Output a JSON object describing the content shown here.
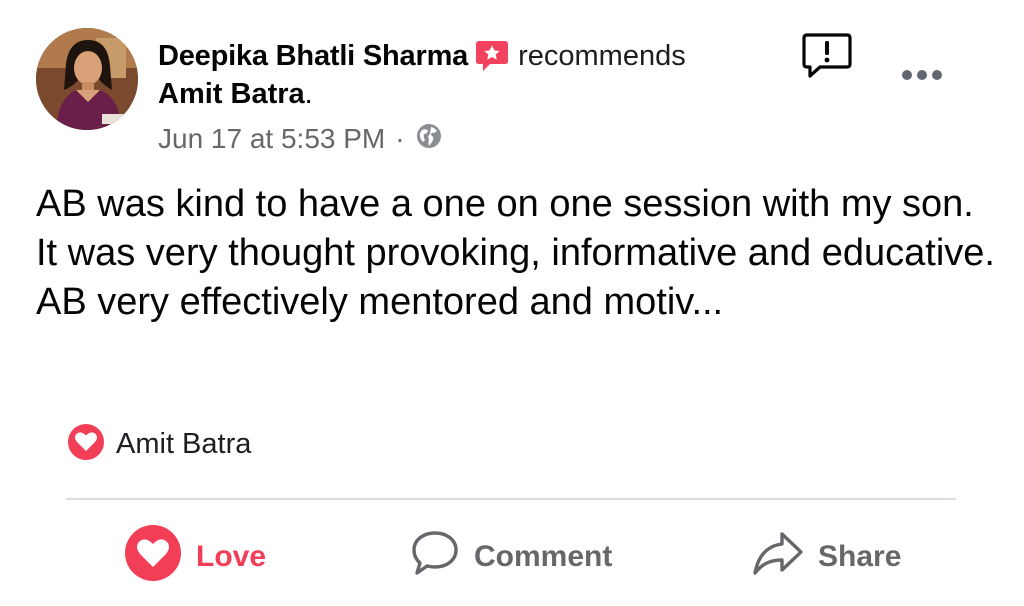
{
  "post": {
    "author": "Deepika Bhatli Sharma",
    "verb": "recommends",
    "target": "Amit Batra",
    "target_suffix": ".",
    "timestamp": "Jun 17 at 5:53 PM",
    "separator": "·",
    "privacy_icon": "globe-icon",
    "body": "AB was kind to have a one on one session with my son. It was very thought provoking, informative and educative. AB very effectively mentored and motiv..."
  },
  "reactions": {
    "icon": "love-reaction-icon",
    "names": "Amit Batra"
  },
  "actions": {
    "love_label": "Love",
    "comment_label": "Comment",
    "share_label": "Share"
  },
  "colors": {
    "love": "#f33e58",
    "secondary_text": "#65676b",
    "divider": "#dadde1",
    "recommend_badge": "#f3425f"
  }
}
